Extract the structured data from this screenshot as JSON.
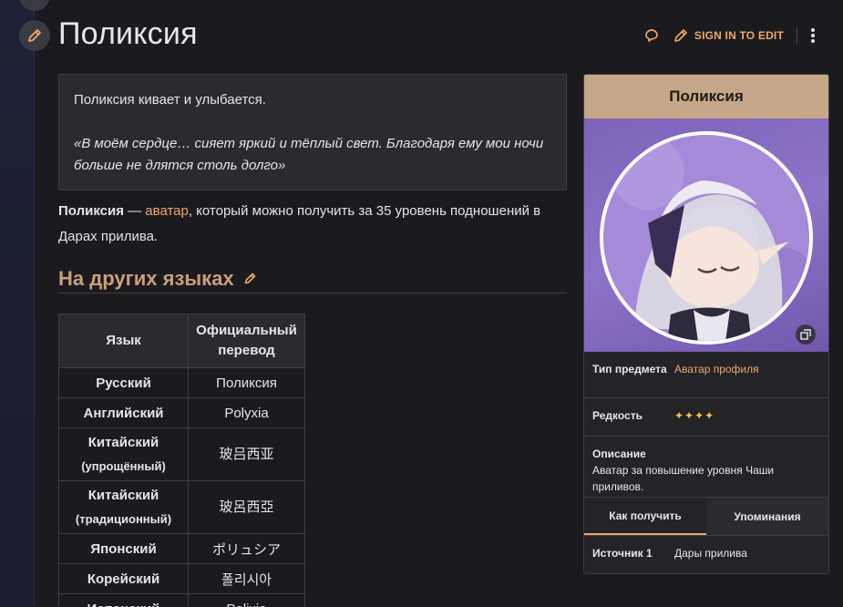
{
  "page": {
    "title": "Поликсия",
    "sign_in_label": "SIGN IN TO EDIT"
  },
  "quote_box": {
    "action": "Поликсия кивает и улыбается.",
    "quote": "«В моём сердце… сияет яркий и тёплый свет. Благодаря ему мои ночи больше не длятся столь долго»"
  },
  "intro": {
    "name": "Поликсия",
    "dash": " — ",
    "link": "аватар",
    "rest": ", который можно получить за 35 уровень подношений в Дарах прилива."
  },
  "section": {
    "heading": "На других языках"
  },
  "lang_table": {
    "headers": [
      "Язык",
      "Официальный перевод"
    ],
    "rows": [
      {
        "lang": "Русский",
        "sub": "",
        "value": "Поликсия"
      },
      {
        "lang": "Английский",
        "sub": "",
        "value": "Polyxia"
      },
      {
        "lang": "Китайский",
        "sub": "(упрощённый)",
        "value": "玻吕西亚"
      },
      {
        "lang": "Китайский",
        "sub": "(традиционный)",
        "value": "玻呂西亞"
      },
      {
        "lang": "Японский",
        "sub": "",
        "value": "ポリュシア"
      },
      {
        "lang": "Корейский",
        "sub": "",
        "value": "폴리시아"
      },
      {
        "lang": "Испанский",
        "sub": "",
        "value": "Polixia"
      }
    ]
  },
  "infobox": {
    "title": "Поликсия",
    "type_label": "Тип предмета",
    "type_value": "Аватар профиля",
    "rarity_label": "Редкость",
    "rarity_value": "✦✦✦✦",
    "desc_label": "Описание",
    "desc_value": "Аватар за повышение уровня Чаши приливов.",
    "tabs": [
      "Как получить",
      "Упоминания"
    ],
    "source_label": "Источник 1",
    "source_value": "Дары прилива"
  },
  "colors": {
    "accent": "#f0a868",
    "heading": "#c9a07a",
    "infobox_header": "#c7a789",
    "image_bg": "#8d74c9"
  }
}
